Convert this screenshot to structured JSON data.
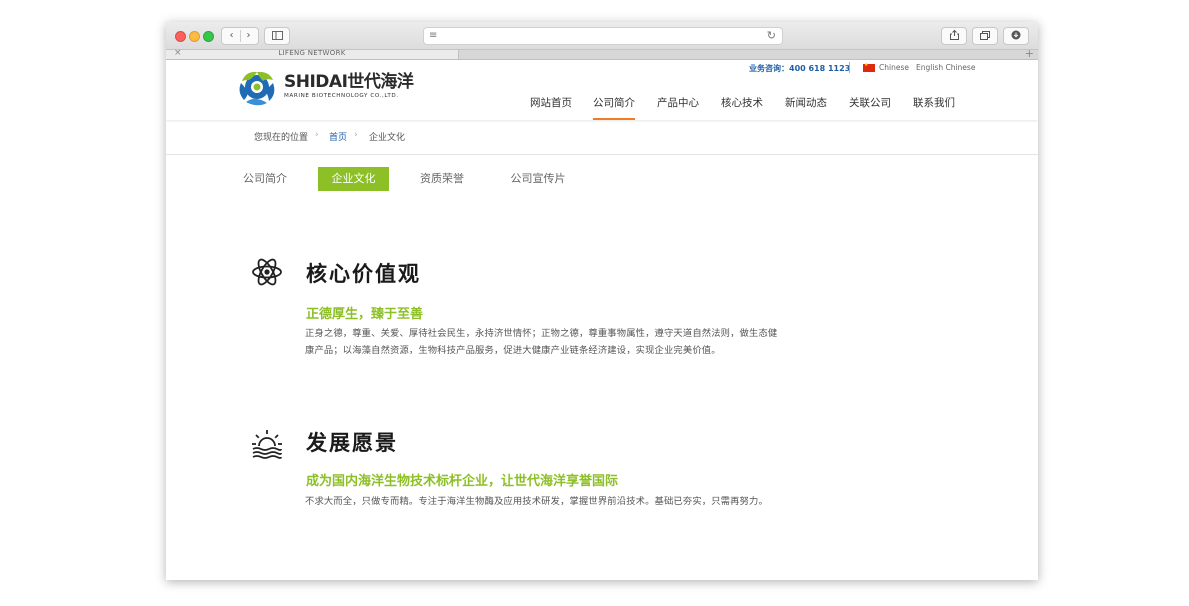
{
  "browser": {
    "tab_title": "LIFENG NETWORK",
    "tab_close": "×",
    "tab_add": "+"
  },
  "header": {
    "logo_name": "SHIDAI世代海洋",
    "logo_subtitle": "MARINE BIOTECHNOLOGY CO.,LTD.",
    "hotline": "业务咨询：400 618 1123",
    "lang_chinese": "Chinese",
    "lang_english": "English  Chinese",
    "nav": [
      {
        "label": "网站首页"
      },
      {
        "label": "公司简介"
      },
      {
        "label": "产品中心"
      },
      {
        "label": "核心技术"
      },
      {
        "label": "新闻动态"
      },
      {
        "label": "关联公司"
      },
      {
        "label": "联系我们"
      }
    ],
    "active_nav_index": 1,
    "accent_color": "#f07d24"
  },
  "breadcrumb": {
    "label": "您现在的位置",
    "separator": "›",
    "home": "首页",
    "current": "企业文化"
  },
  "subnav": {
    "items": [
      {
        "label": "公司简介"
      },
      {
        "label": "企业文化"
      },
      {
        "label": "资质荣誉"
      },
      {
        "label": "公司宣传片"
      }
    ],
    "active_index": 1,
    "active_color": "#8cc026"
  },
  "sections": [
    {
      "icon": "atom-icon",
      "title": "核心价值观",
      "subtitle": "正德厚生，臻于至善",
      "body": "正身之德，尊重、关爱、厚待社会民生，永持济世情怀；正物之德，尊重事物属性，遵守天道自然法则，做生态健康产品；以海藻自然资源，生物科技产品服务，促进大健康产业链条经济建设，实现企业完美价值。"
    },
    {
      "icon": "sunrise-icon",
      "title": "发展愿景",
      "subtitle": "成为国内海洋生物技术标杆企业，让世代海洋享誉国际",
      "body": "不求大而全，只做专而精。专注于海洋生物酶及应用技术研发，掌握世界前沿技术。基础已夯实，只需再努力。"
    }
  ]
}
